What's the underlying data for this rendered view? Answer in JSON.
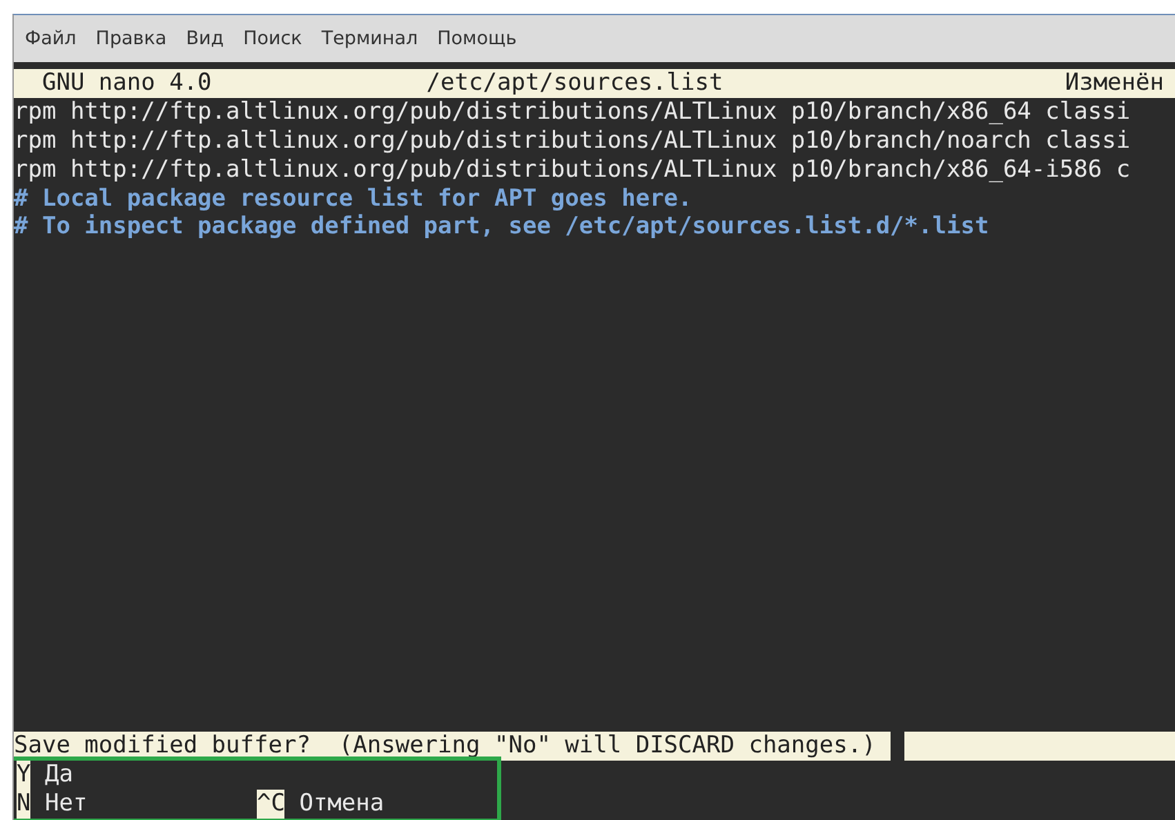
{
  "menu": [
    "Файл",
    "Правка",
    "Вид",
    "Поиск",
    "Терминал",
    "Помощь"
  ],
  "titlebar": {
    "app": "GNU nano 4.0",
    "file": "/etc/apt/sources.list",
    "status": "Изменён"
  },
  "lines": [
    {
      "kind": "plain",
      "text": "rpm http://ftp.altlinux.org/pub/distributions/ALTLinux p10/branch/x86_64 classi"
    },
    {
      "kind": "plain",
      "text": "rpm http://ftp.altlinux.org/pub/distributions/ALTLinux p10/branch/noarch classi"
    },
    {
      "kind": "plain",
      "text": "rpm http://ftp.altlinux.org/pub/distributions/ALTLinux p10/branch/x86_64-i586 c"
    },
    {
      "kind": "comment",
      "text": "# Local package resource list for APT goes here."
    },
    {
      "kind": "comment",
      "text": "# To inspect package defined part, see /etc/apt/sources.list.d/*.list"
    }
  ],
  "prompt": {
    "text": "Save modified buffer?  (Answering \"No\" will DISCARD changes.)"
  },
  "shortcuts": {
    "highlighted": true,
    "rows": [
      [
        {
          "key": "Y",
          "label": "Да"
        }
      ],
      [
        {
          "key": "N",
          "label": "Нет"
        },
        {
          "key": "^C",
          "label": "Отмена"
        }
      ]
    ]
  }
}
